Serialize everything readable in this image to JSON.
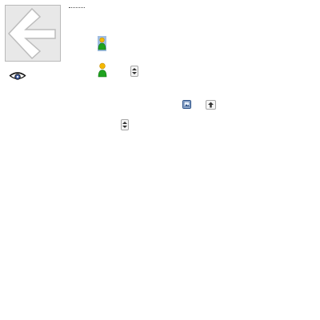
{
  "toolbar": {
    "back_icon": "left-arrow-icon",
    "visibility_icon": "eye-icon"
  },
  "form": {
    "selected_user_icon": "user-icon",
    "user_icon": "user-icon",
    "spinner_icon": "up-down-spinner-icon",
    "image_icon": "image-icon",
    "move_up_icon": "up-arrow-icon"
  },
  "colors": {
    "selection": "#9fbde2",
    "user_head": "#f5b800",
    "user_body": "#1fa31f",
    "panel_bg": "#e8e8e8"
  }
}
